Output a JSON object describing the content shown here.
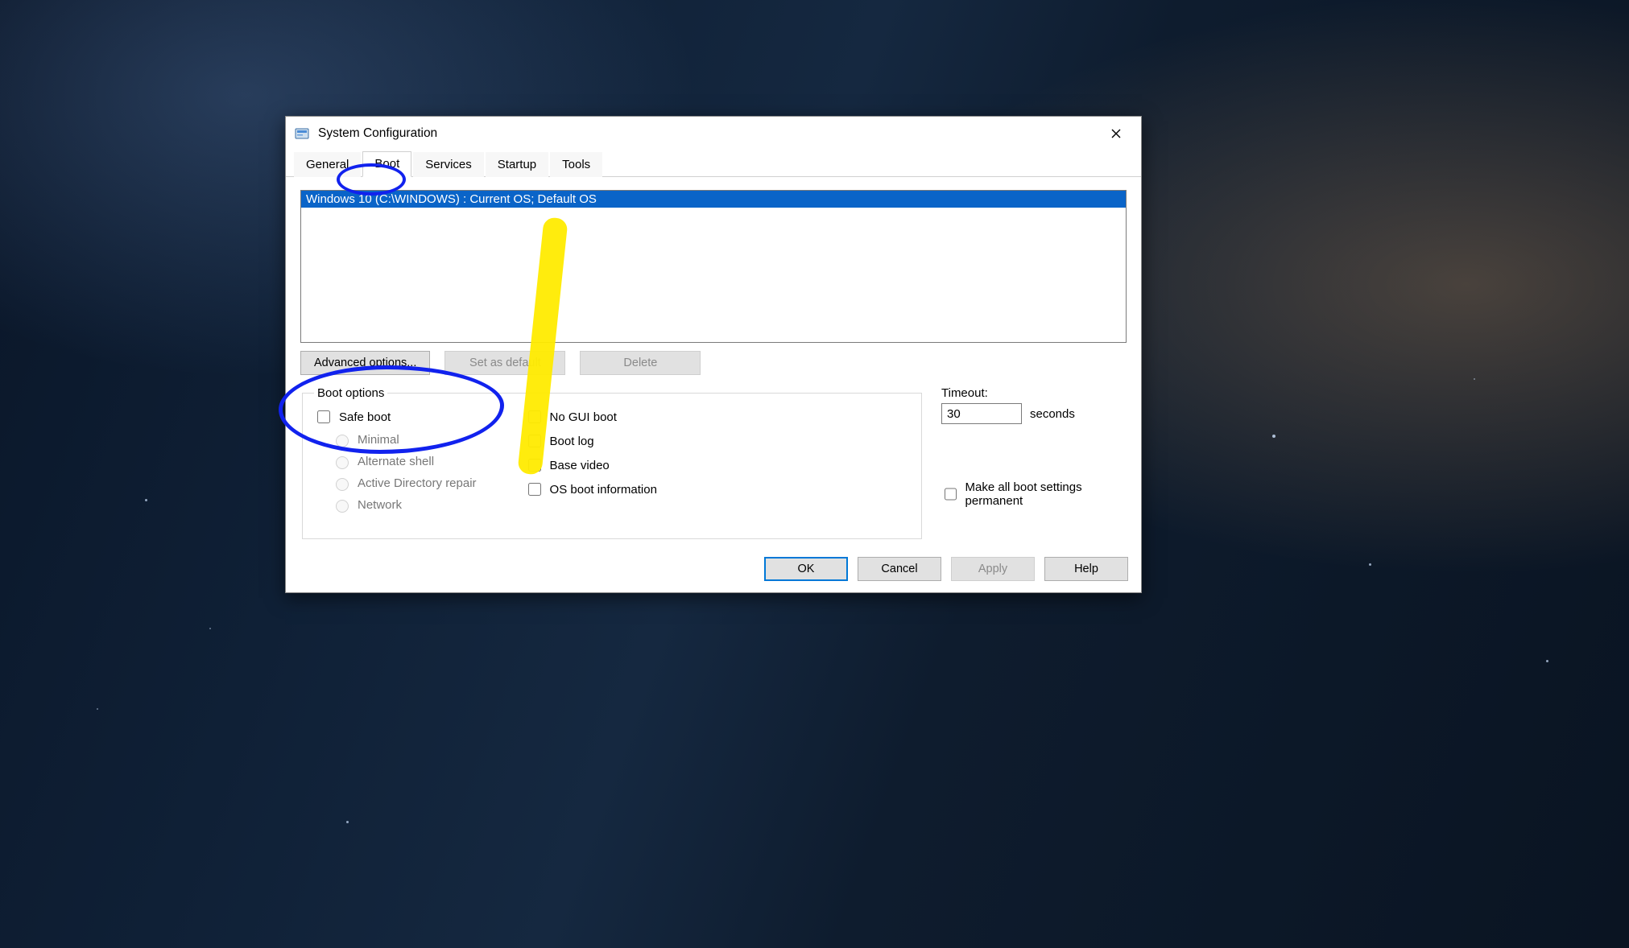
{
  "window": {
    "title": "System Configuration"
  },
  "tabs": {
    "general": "General",
    "boot": "Boot",
    "services": "Services",
    "startup": "Startup",
    "tools": "Tools",
    "active": "boot"
  },
  "os_list": {
    "selected": "Windows 10 (C:\\WINDOWS) : Current OS; Default OS"
  },
  "buttons": {
    "advanced": "Advanced options...",
    "set_default": "Set as default",
    "delete": "Delete",
    "ok": "OK",
    "cancel": "Cancel",
    "apply": "Apply",
    "help": "Help"
  },
  "boot_options": {
    "legend": "Boot options",
    "safe_boot": "Safe boot",
    "minimal": "Minimal",
    "alt_shell": "Alternate shell",
    "ad_repair": "Active Directory repair",
    "network": "Network",
    "no_gui": "No GUI boot",
    "boot_log": "Boot log",
    "base_video": "Base video",
    "os_boot_info": "OS boot information"
  },
  "timeout": {
    "label": "Timeout:",
    "value": "30",
    "unit": "seconds"
  },
  "permanent_label": "Make all boot settings permanent"
}
